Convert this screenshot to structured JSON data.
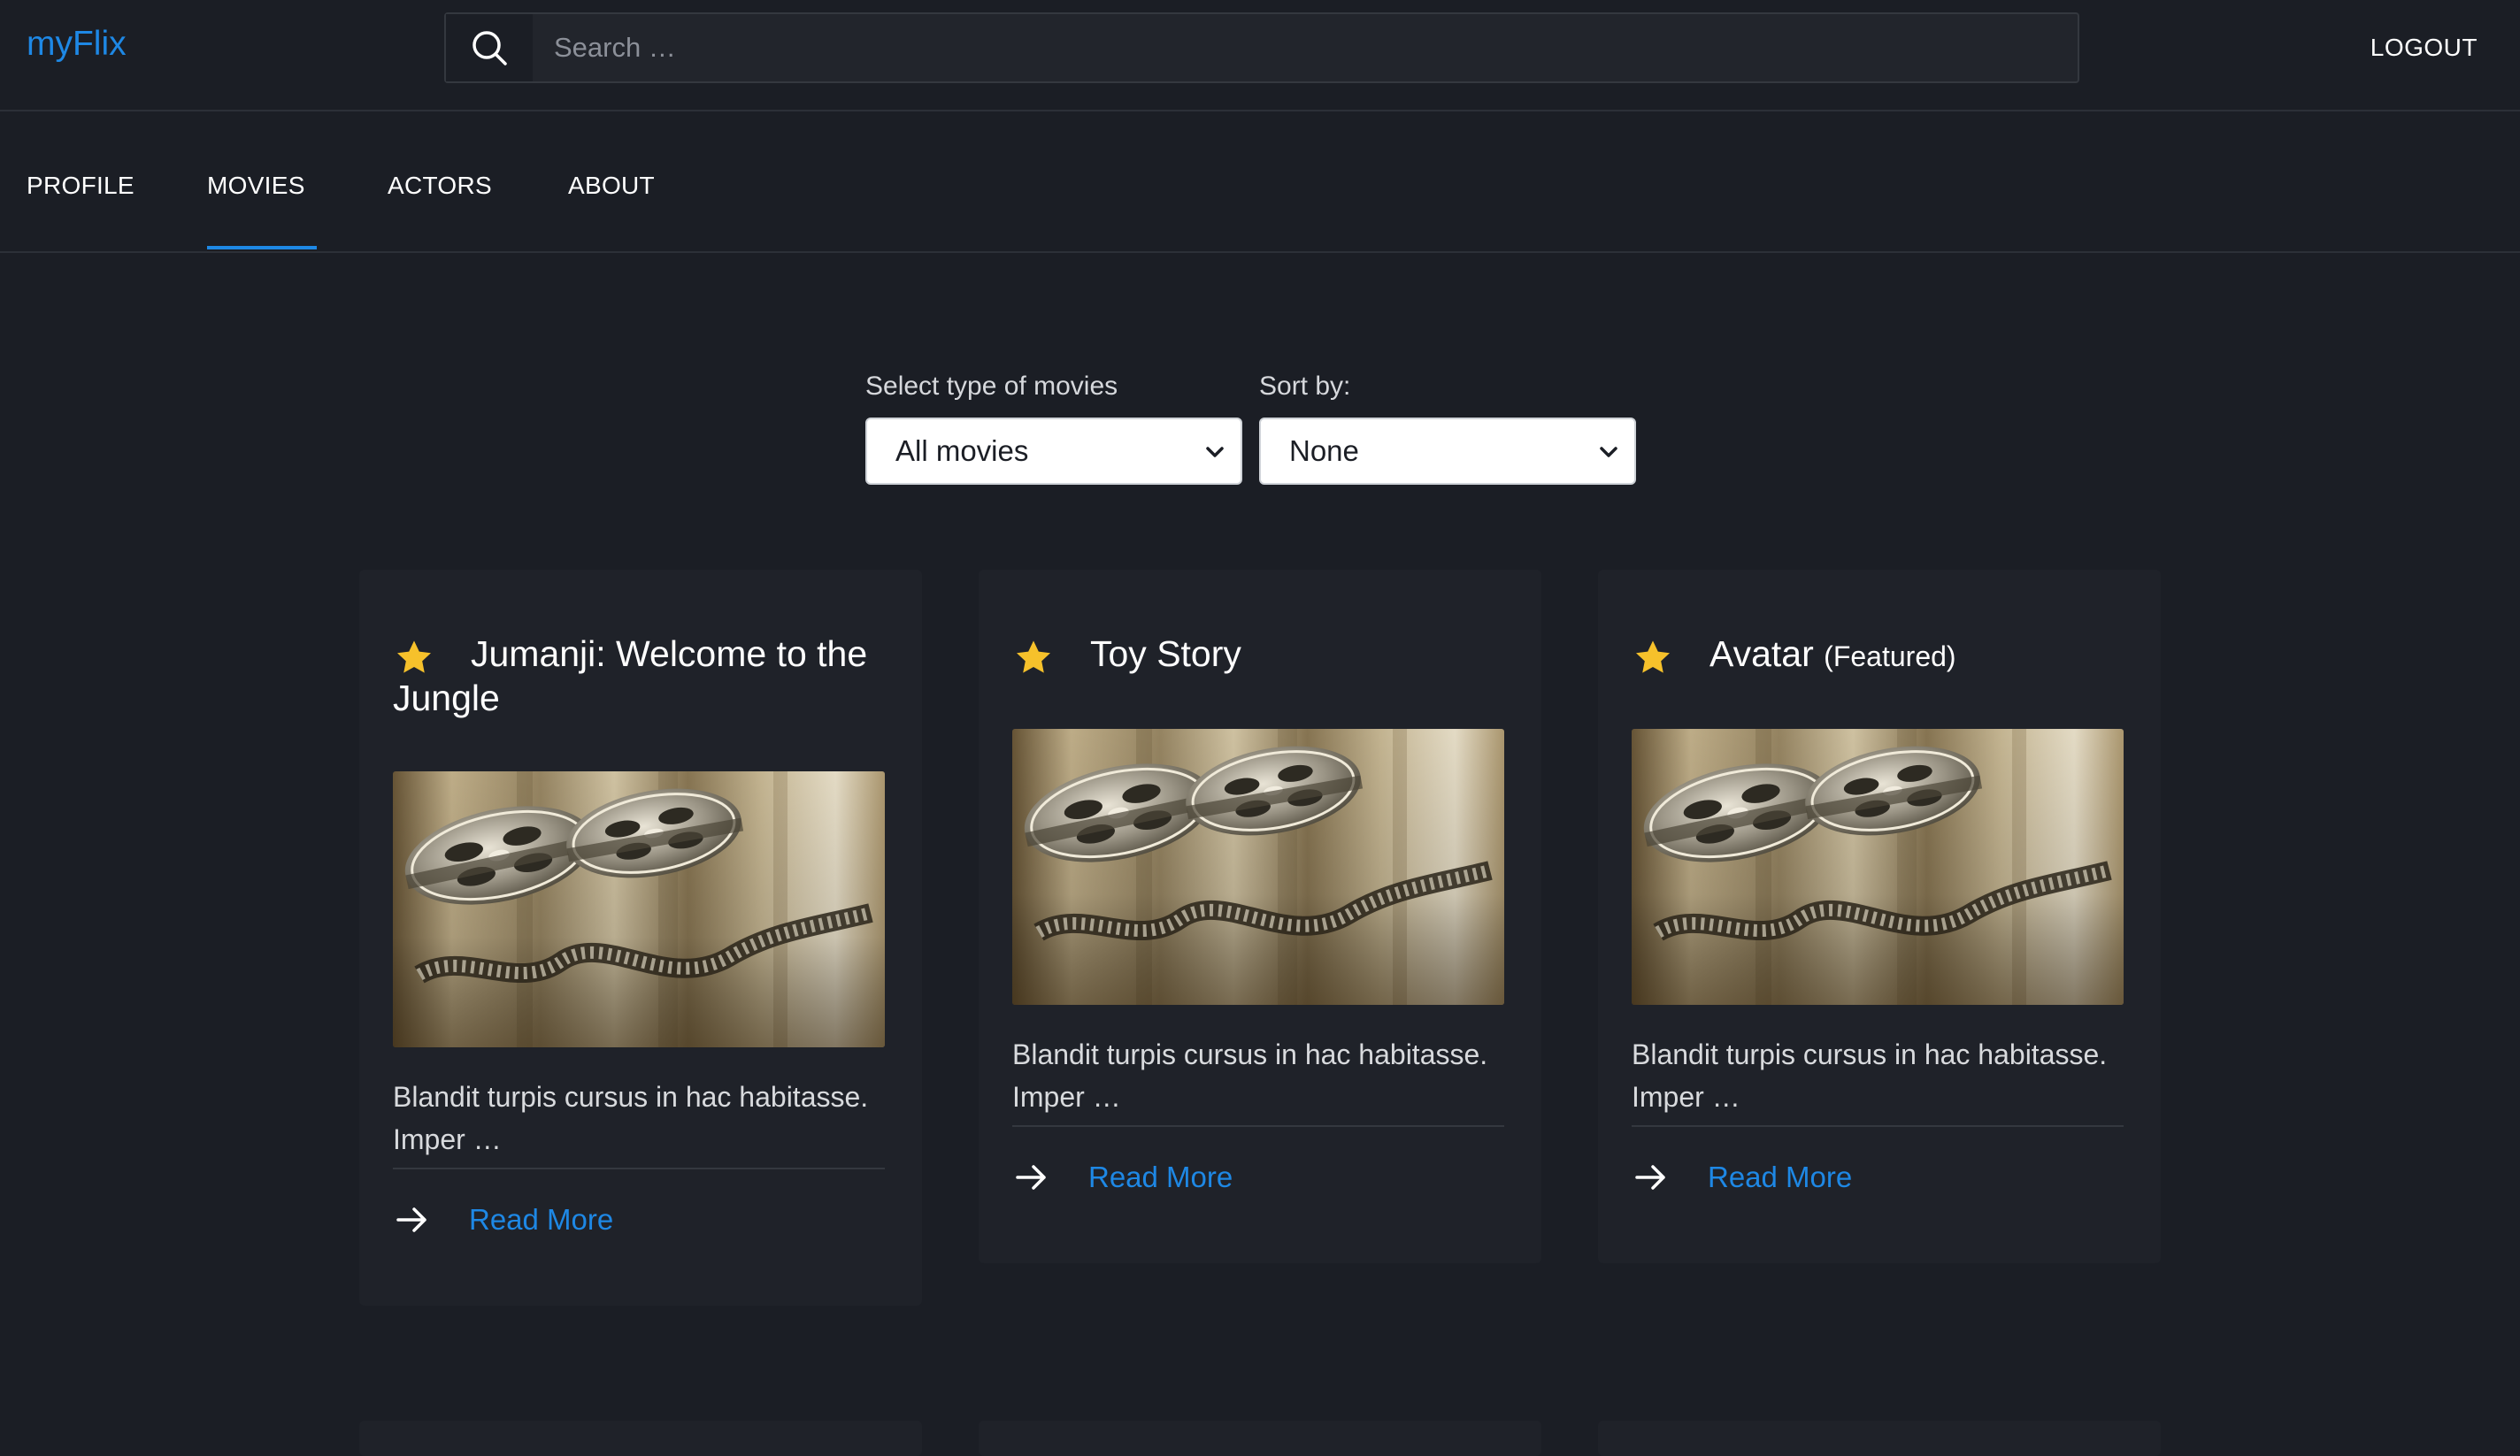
{
  "app": {
    "brand": "myFlix",
    "logout_label": "LOGOUT"
  },
  "search": {
    "placeholder": "Search …",
    "value": ""
  },
  "nav": {
    "tabs": [
      {
        "label": "PROFILE",
        "active": false
      },
      {
        "label": "MOVIES",
        "active": true
      },
      {
        "label": "ACTORS",
        "active": false
      },
      {
        "label": "ABOUT",
        "active": false
      }
    ],
    "accent": "#1e88e5"
  },
  "filters": {
    "type_label": "Select type of movies",
    "type_value": "All movies",
    "sort_label": "Sort by:",
    "sort_value": "None"
  },
  "movies": [
    {
      "title": "Jumanji: Welcome to the Jungle",
      "suffix": "",
      "description": "Blandit turpis cursus in hac habitasse. Imper …",
      "link_label": "Read More",
      "favorite": true,
      "image": "film-reels"
    },
    {
      "title": "Toy Story",
      "suffix": "",
      "description": "Blandit turpis cursus in hac habitasse. Imper …",
      "link_label": "Read More",
      "favorite": true,
      "image": "film-reels"
    },
    {
      "title": "Avatar",
      "suffix": "(Featured)",
      "description": "Blandit turpis cursus in hac habitasse. Imper …",
      "link_label": "Read More",
      "favorite": true,
      "image": "film-reels"
    }
  ],
  "colors": {
    "background": "#1b1e25",
    "card": "#1f2229",
    "accent": "#1e88e5",
    "star": "#f6c12b"
  }
}
